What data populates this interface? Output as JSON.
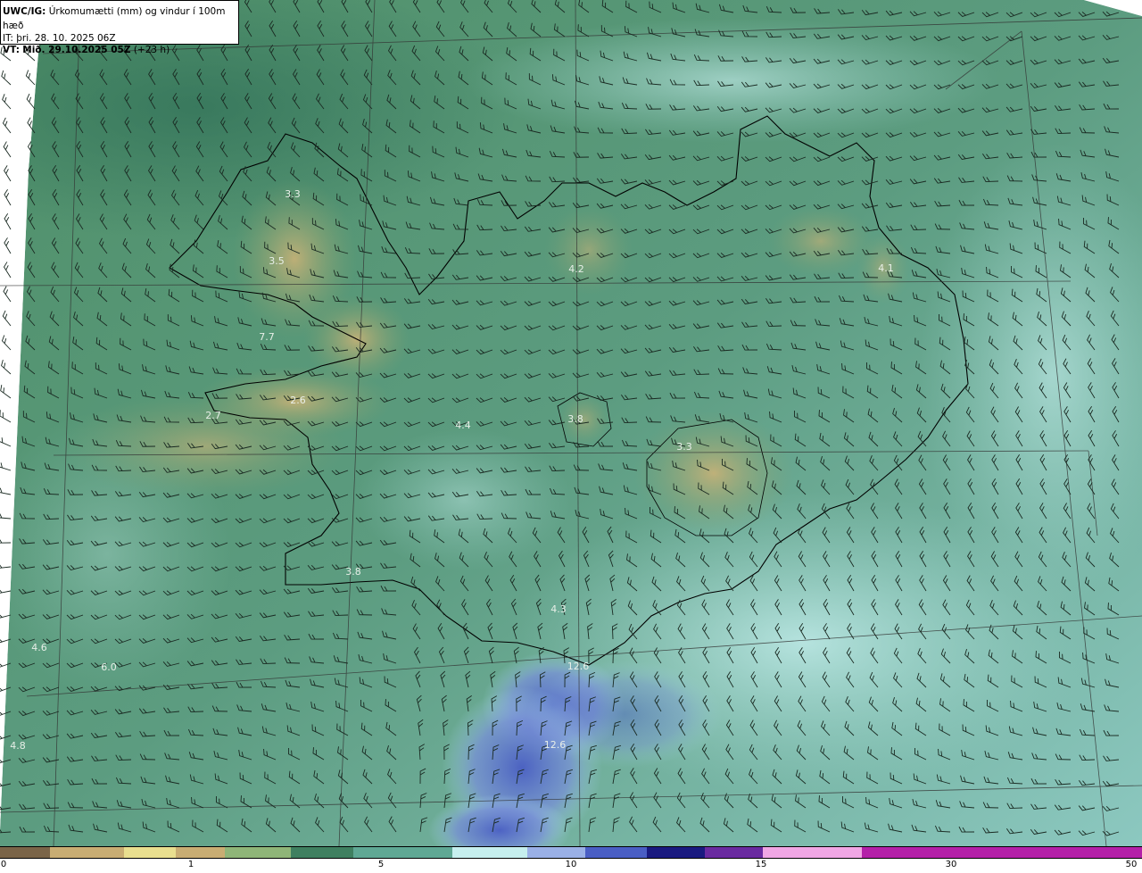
{
  "header": {
    "model": "UWC/IG:",
    "title": "Úrkomumætti (mm) og vindur í 100m hæð",
    "it_label": "IT:",
    "it_value": "þri. 28. 10. 2025 06Z",
    "vt_label": "VT:",
    "vt_value": "Mið. 29.10.2025 05Z",
    "lead": "(+23 h)"
  },
  "map_labels": [
    {
      "text": "3.3"
    },
    {
      "text": "3.5"
    },
    {
      "text": "7.7"
    },
    {
      "text": "2.6"
    },
    {
      "text": "2.7"
    },
    {
      "text": "4.4"
    },
    {
      "text": "3.8"
    },
    {
      "text": "3.3"
    },
    {
      "text": "4.2"
    },
    {
      "text": "4.1"
    },
    {
      "text": "3.8"
    },
    {
      "text": "4.3"
    },
    {
      "text": "12.6"
    },
    {
      "text": "12.6"
    },
    {
      "text": "4.6"
    },
    {
      "text": "6.0"
    },
    {
      "text": "4.8"
    }
  ],
  "colorbar": {
    "ticks": [
      "0",
      "1",
      "5",
      "10",
      "15",
      "30",
      "50"
    ],
    "colors": {
      "brown": "#7a6448",
      "tan": "#c9ad73",
      "yellow": "#e9df8f",
      "green_light": "#8fb578",
      "green": "#3f8060",
      "teal": "#5fa894",
      "cyan_light": "#c6efee",
      "blue_light": "#9ab0e6",
      "blue": "#4a5ec4",
      "navy": "#1a1a80",
      "purple": "#6a2aa0",
      "pink": "#f0a6e4",
      "magenta": "#b420a8"
    }
  },
  "icons": {
    "wind": "wind-barb-icon"
  }
}
